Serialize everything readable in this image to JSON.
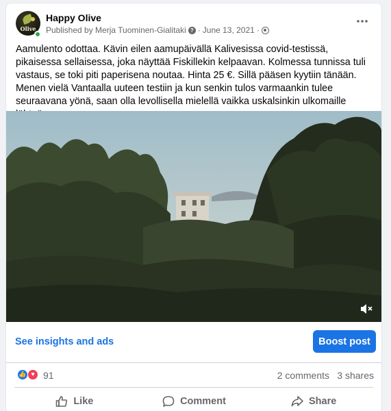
{
  "post": {
    "page_name": "Happy Olive",
    "avatar_text": "Olive",
    "published_by": "Published by Merja Tuominen-Gialitaki",
    "date": "June 13, 2021",
    "separator": "·",
    "text": "Aamulento odottaa. Kävin eilen aamupäivällä Kalivesissa covid-testissä, pikaisessa sellaisessa, joka näyttää Fiskillekin kelpaavan. Kolmessa tunnissa tuli vastaus, se toki piti paperisena noutaa. Hinta 25 €. Sillä pääsen kyytiin tänään. Menen vielä Vantaalla uuteen testiin  ja kun senkin tulos varmaankin tulee seuraavana yönä, saan olla levollisella mielellä vaikka uskalsinkin ulkomaille lähteä."
  },
  "insights": {
    "link_label": "See insights and ads",
    "boost_label": "Boost post"
  },
  "stats": {
    "reactions_count": "91",
    "comments": "2 comments",
    "shares": "3 shares"
  },
  "actions": {
    "like": "Like",
    "comment": "Comment",
    "share": "Share"
  },
  "icons": {
    "more": "more-horizontal-icon",
    "mute": "muted-speaker-icon",
    "globe": "globe-icon",
    "info": "info-icon"
  },
  "colors": {
    "accent": "#1b74e4",
    "like_reaction": "#1877f2",
    "love_reaction": "#f33e58",
    "online": "#31a24c"
  }
}
